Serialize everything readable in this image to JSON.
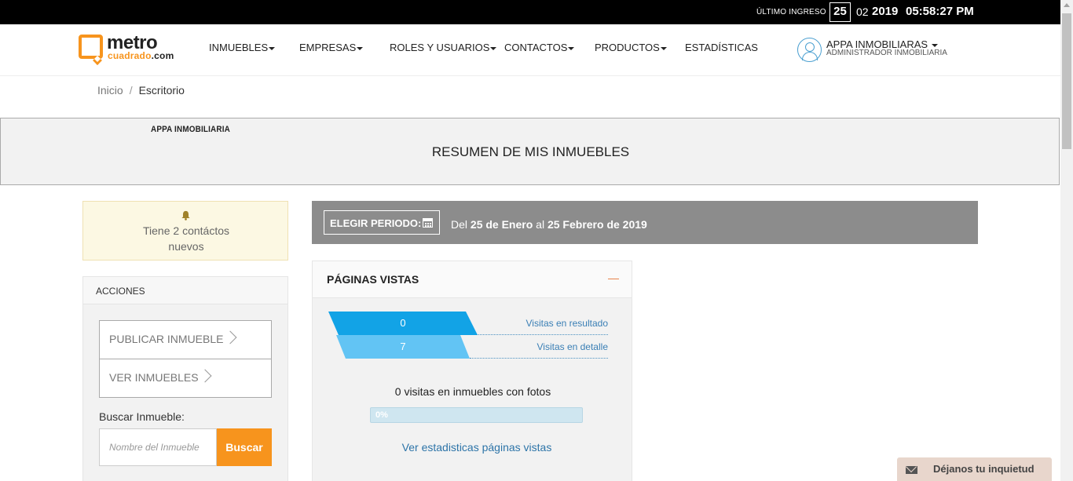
{
  "topbar": {
    "last_login_label": "ÚLTIMO INGRESO",
    "day": "25",
    "month": "02",
    "year": "2019",
    "time": "05:58:27 PM"
  },
  "brand": {
    "name_top": "metro",
    "name_bottom": "cuadrado",
    "name_tld": ".com",
    "accent_color": "#f7941d"
  },
  "nav": {
    "items": [
      {
        "label": "INMUEBLES",
        "dropdown": true
      },
      {
        "label": "EMPRESAS",
        "dropdown": true
      },
      {
        "label": "ROLES Y USUARIOS",
        "dropdown": true
      },
      {
        "label": "CONTACTOS",
        "dropdown": true
      },
      {
        "label": "PRODUCTOS",
        "dropdown": true
      },
      {
        "label": "ESTADÍSTICAS",
        "dropdown": false
      }
    ]
  },
  "user": {
    "name": "APPA INMOBILIARAS",
    "role": "ADMINISTRADOR INMOBILIARIA",
    "icon": "user-circle-icon"
  },
  "breadcrumb": {
    "home": "Inicio",
    "separator": "/",
    "current": "Escritorio"
  },
  "summary": {
    "company": "APPA INMOBILIARIA",
    "title": "RESUMEN DE MIS INMUEBLES"
  },
  "notice": {
    "icon": "bell-icon",
    "text": "Tiene 2 contáctos nuevos"
  },
  "actions": {
    "header": "ACCIONES",
    "publish_label": "PUBLICAR INMUEBLE",
    "view_label": "VER INMUEBLES",
    "search_label": "Buscar Inmueble:",
    "search_placeholder": "Nombre del Inmueble",
    "search_button": "Buscar"
  },
  "period": {
    "button_label": "ELEGIR PERIODO:",
    "text_prefix": "Del",
    "from": "25 de Enero",
    "connector": "al",
    "to": "25 Febrero de 2019"
  },
  "pages_viewed": {
    "title": "PÁGINAS VISTAS",
    "rows": [
      {
        "value": "0",
        "label": "Visitas en resultado",
        "color": "#12a3e6"
      },
      {
        "value": "7",
        "label": "Visitas en detalle",
        "color": "#62c4f4"
      }
    ],
    "photos_text": "0 visitas en inmuebles con fotos",
    "photos_progress_label": "0%",
    "photos_progress": 0,
    "stats_link": "Ver estadisticas páginas vistas"
  },
  "feedback": {
    "label": "Déjanos tu inquietud",
    "icon": "envelope-icon"
  }
}
